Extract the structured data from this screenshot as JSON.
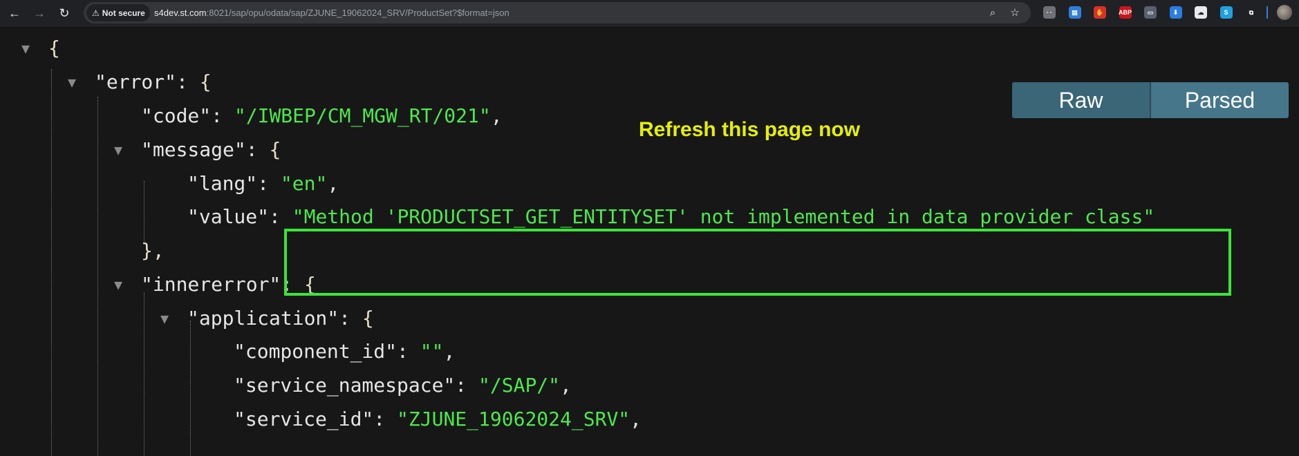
{
  "browser": {
    "security_label": "Not secure",
    "url_host": "s4dev.st.com",
    "url_path": ":8021/sap/opu/odata/sap/ZJUNE_19062024_SRV/ProductSet?$format=json",
    "nav_icons": [
      "back-arrow-icon",
      "forward-arrow-icon",
      "reload-icon"
    ],
    "omnibox_icons": [
      "zoom-icon",
      "bookmark-star-icon"
    ],
    "extensions": [
      {
        "name": "glasses-extension-icon",
        "color": "#6f7177",
        "glyph": "👓"
      },
      {
        "name": "document-extension-icon",
        "color": "#2f7fd9",
        "glyph": "▤"
      },
      {
        "name": "stop-hand-extension-icon",
        "color": "#d9302c",
        "glyph": "✋"
      },
      {
        "name": "abp-extension-icon",
        "color": "#c8161d",
        "glyph": "ABP"
      },
      {
        "name": "card-extension-icon",
        "color": "#5a6070",
        "glyph": "▭"
      },
      {
        "name": "download-extension-icon",
        "color": "#2a7de1",
        "glyph": "⬇"
      },
      {
        "name": "cloud-extension-icon",
        "color": "#e8eaed",
        "glyph": "☁"
      },
      {
        "name": "s-extension-icon",
        "color": "#1fa1e0",
        "glyph": "S"
      },
      {
        "name": "puzzle-extensions-icon",
        "color": "#202124",
        "glyph": "⧉"
      }
    ]
  },
  "viewer": {
    "annotation": "Refresh this page now",
    "toggle": {
      "raw": "Raw",
      "parsed": "Parsed"
    },
    "json": {
      "l1": "{",
      "error_key": "\"error\"",
      "code_key": "\"code\"",
      "code_val": "\"/IWBEP/CM_MGW_RT/021\"",
      "message_key": "\"message\"",
      "lang_key": "\"lang\"",
      "lang_val": "\"en\"",
      "value_key": "\"value\"",
      "value_val": "\"Method 'PRODUCTSET_GET_ENTITYSET' not implemented in data provider class\"",
      "close_msg": "},",
      "innererror_key": "\"innererror\"",
      "application_key": "\"application\"",
      "component_id_key": "\"component_id\"",
      "component_id_val": "\"\"",
      "service_namespace_key": "\"service_namespace\"",
      "service_namespace_val": "\"/SAP/\"",
      "service_id_key": "\"service_id\"",
      "service_id_val": "\"ZJUNE_19062024_SRV\""
    }
  },
  "colors": {
    "string": "#4de84d",
    "annotation": "#e6f000",
    "highlight": "#39e639",
    "toggle_bg": "#3b6678"
  }
}
